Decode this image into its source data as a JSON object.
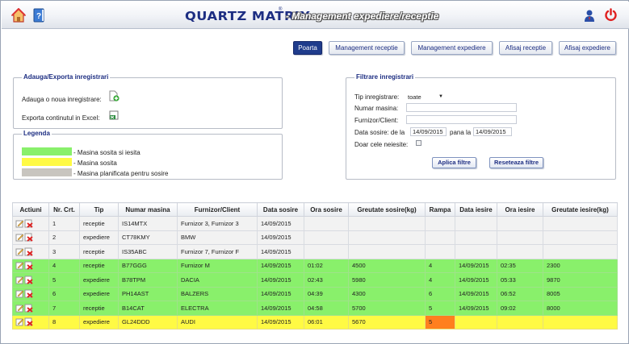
{
  "header": {
    "brand": "QUARTZ MATRIX",
    "reg": "®",
    "subtitle": "- Management expediere/receptie"
  },
  "nav": [
    {
      "label": "Poarta",
      "active": true
    },
    {
      "label": "Management receptie"
    },
    {
      "label": "Management expediere"
    },
    {
      "label": "Afisaj receptie"
    },
    {
      "label": "Afisaj expediere"
    }
  ],
  "export_panel": {
    "title": "Adauga/Exporta inregistrari",
    "add_label": "Adauga o noua inregistrare:",
    "export_label": "Exporta continutul in Excel:"
  },
  "legend_panel": {
    "title": "Legenda",
    "items": [
      {
        "label": "- Masina sosita si iesita",
        "color": "#89f06b"
      },
      {
        "label": "- Masina sosita",
        "color": "#fffa44"
      },
      {
        "label": "- Masina planificata pentru sosire",
        "color": "#c8c5bf"
      }
    ]
  },
  "filter_panel": {
    "title": "Filtrare inregistrari",
    "type_label": "Tip inregistrare:",
    "type_value": "toate",
    "plate_label": "Numar masina:",
    "plate_value": "",
    "supplier_label": "Furnizor/Client:",
    "supplier_value": "",
    "date_label": "Data sosire: de la",
    "date_from": "14/09/2015",
    "date_to_label": "pana la",
    "date_to": "14/09/2015",
    "unexited_label": "Doar cele neiesite:",
    "apply_label": "Aplica filtre",
    "reset_label": "Reseteaza filtre"
  },
  "table": {
    "columns": [
      "Actiuni",
      "Nr. Crt.",
      "Tip",
      "Numar masina",
      "Furnizor/Client",
      "Data sosire",
      "Ora sosire",
      "Greutate sosire(kg)",
      "Rampa",
      "Data iesire",
      "Ora iesire",
      "Greutate iesire(kg)"
    ],
    "rows": [
      {
        "status": "white",
        "cells": [
          "1",
          "receptie",
          "IS14MTX",
          "Furnizor 3, Furnizor 3",
          "14/09/2015",
          "",
          "",
          "",
          "",
          "",
          ""
        ]
      },
      {
        "status": "white",
        "cells": [
          "2",
          "expediere",
          "CT78KMY",
          "BMW",
          "14/09/2015",
          "",
          "",
          "",
          "",
          "",
          ""
        ]
      },
      {
        "status": "white",
        "cells": [
          "3",
          "receptie",
          "IS35ABC",
          "Furnizor 7, Furnizor F",
          "14/09/2015",
          "",
          "",
          "",
          "",
          "",
          ""
        ]
      },
      {
        "status": "green",
        "cells": [
          "4",
          "receptie",
          "B77GGG",
          "Furnizor M",
          "14/09/2015",
          "01:02",
          "4500",
          "4",
          "14/09/2015",
          "02:35",
          "2300"
        ]
      },
      {
        "status": "green",
        "cells": [
          "5",
          "expediere",
          "B78TPM",
          "DACIA",
          "14/09/2015",
          "02:43",
          "5980",
          "4",
          "14/09/2015",
          "05:33",
          "9870"
        ]
      },
      {
        "status": "green",
        "cells": [
          "6",
          "expediere",
          "PH14AST",
          "BALZERS",
          "14/09/2015",
          "04:39",
          "4300",
          "6",
          "14/09/2015",
          "06:52",
          "8005"
        ]
      },
      {
        "status": "green",
        "cells": [
          "7",
          "receptie",
          "B14CAT",
          "ELECTRA",
          "14/09/2015",
          "04:58",
          "5700",
          "5",
          "14/09/2015",
          "09:02",
          "8000"
        ]
      },
      {
        "status": "yellow",
        "rampa_highlight": true,
        "cells": [
          "8",
          "expediere",
          "GL24DDD",
          "AUDI",
          "14/09/2015",
          "06:01",
          "5670",
          "5",
          "",
          "",
          ""
        ]
      }
    ]
  }
}
